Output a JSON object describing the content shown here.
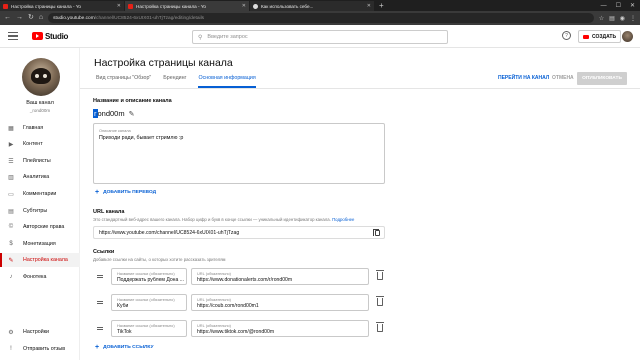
{
  "browser": {
    "tabs": [
      {
        "title": "Настройка страницы канала - Yo",
        "active": false
      },
      {
        "title": "Настройка страницы канала - Yo",
        "active": true
      },
      {
        "title": "Как использовать себе...",
        "active": false
      }
    ],
    "new_tab": "+",
    "url_host": "studio.youtube.com",
    "url_path": "/channel/UC8524-6xUIX01-uhTjTzag/editing/details"
  },
  "header": {
    "logo_text": "Studio",
    "search_placeholder": "Введите запрос",
    "help": "?",
    "create_label": "СОЗДАТЬ"
  },
  "sidebar": {
    "channel_name": "Ваш канал",
    "channel_handle": "_rond00m",
    "items": [
      {
        "label": "Главная",
        "icon": "dashboard-icon"
      },
      {
        "label": "Контент",
        "icon": "content-icon"
      },
      {
        "label": "Плейлисты",
        "icon": "playlists-icon"
      },
      {
        "label": "Аналитика",
        "icon": "analytics-icon"
      },
      {
        "label": "Комментарии",
        "icon": "comments-icon"
      },
      {
        "label": "Субтитры",
        "icon": "subtitles-icon"
      },
      {
        "label": "Авторские права",
        "icon": "copyright-icon"
      },
      {
        "label": "Монетизация",
        "icon": "monetization-icon"
      },
      {
        "label": "Настройка канала",
        "icon": "customization-icon",
        "active": true
      },
      {
        "label": "Фонотека",
        "icon": "audio-library-icon"
      }
    ],
    "bottom_items": [
      {
        "label": "Настройки",
        "icon": "settings-icon"
      },
      {
        "label": "Отправить отзыв",
        "icon": "feedback-icon"
      }
    ]
  },
  "page": {
    "title": "Настройка страницы канала",
    "tabs": [
      "Вид страницы \"Обзор\"",
      "Брендинг",
      "Основная информация"
    ],
    "active_tab": 2,
    "actions": {
      "go_to_channel": "ПЕРЕЙТИ НА КАНАЛ",
      "cancel": "ОТМЕНА",
      "publish": "ОПУБЛИКОВАТЬ"
    }
  },
  "name_section": {
    "title": "Название и описание канала",
    "channel_name": "rond00m",
    "name_cursor": "r",
    "description_label": "Описание канала",
    "description_value": "Приходи ради, бывает стримлю :р",
    "add_translation": "ДОБАВИТЬ ПЕРЕВОД"
  },
  "url_section": {
    "title": "URL канала",
    "desc": "Это стандартный веб-адрес вашего канала. Набор цифр и букв в конце ссылки — уникальный идентификатор канала.",
    "desc_link": "Подробнее",
    "url": "https://www.youtube.com/channel/UC8524-6xUIX01-uhTjTzag"
  },
  "links_section": {
    "title": "Ссылки",
    "desc": "Добавьте ссылки на сайты, о которых хотите рассказать зрителям",
    "title_label": "Название ссылки (обязательно)",
    "url_label": "URL (обязательно)",
    "links": [
      {
        "title": "Поддержать рублем Дона ...",
        "url": "https://www.donationalerts.com/r/rond00m"
      },
      {
        "title": "Куби",
        "url": "https://coub.com/rond00m1"
      },
      {
        "title": "TikTok",
        "url": "https://www.tiktok.com/@rond00m"
      }
    ],
    "add_link": "ДОБАВИТЬ ССЫЛКУ"
  }
}
